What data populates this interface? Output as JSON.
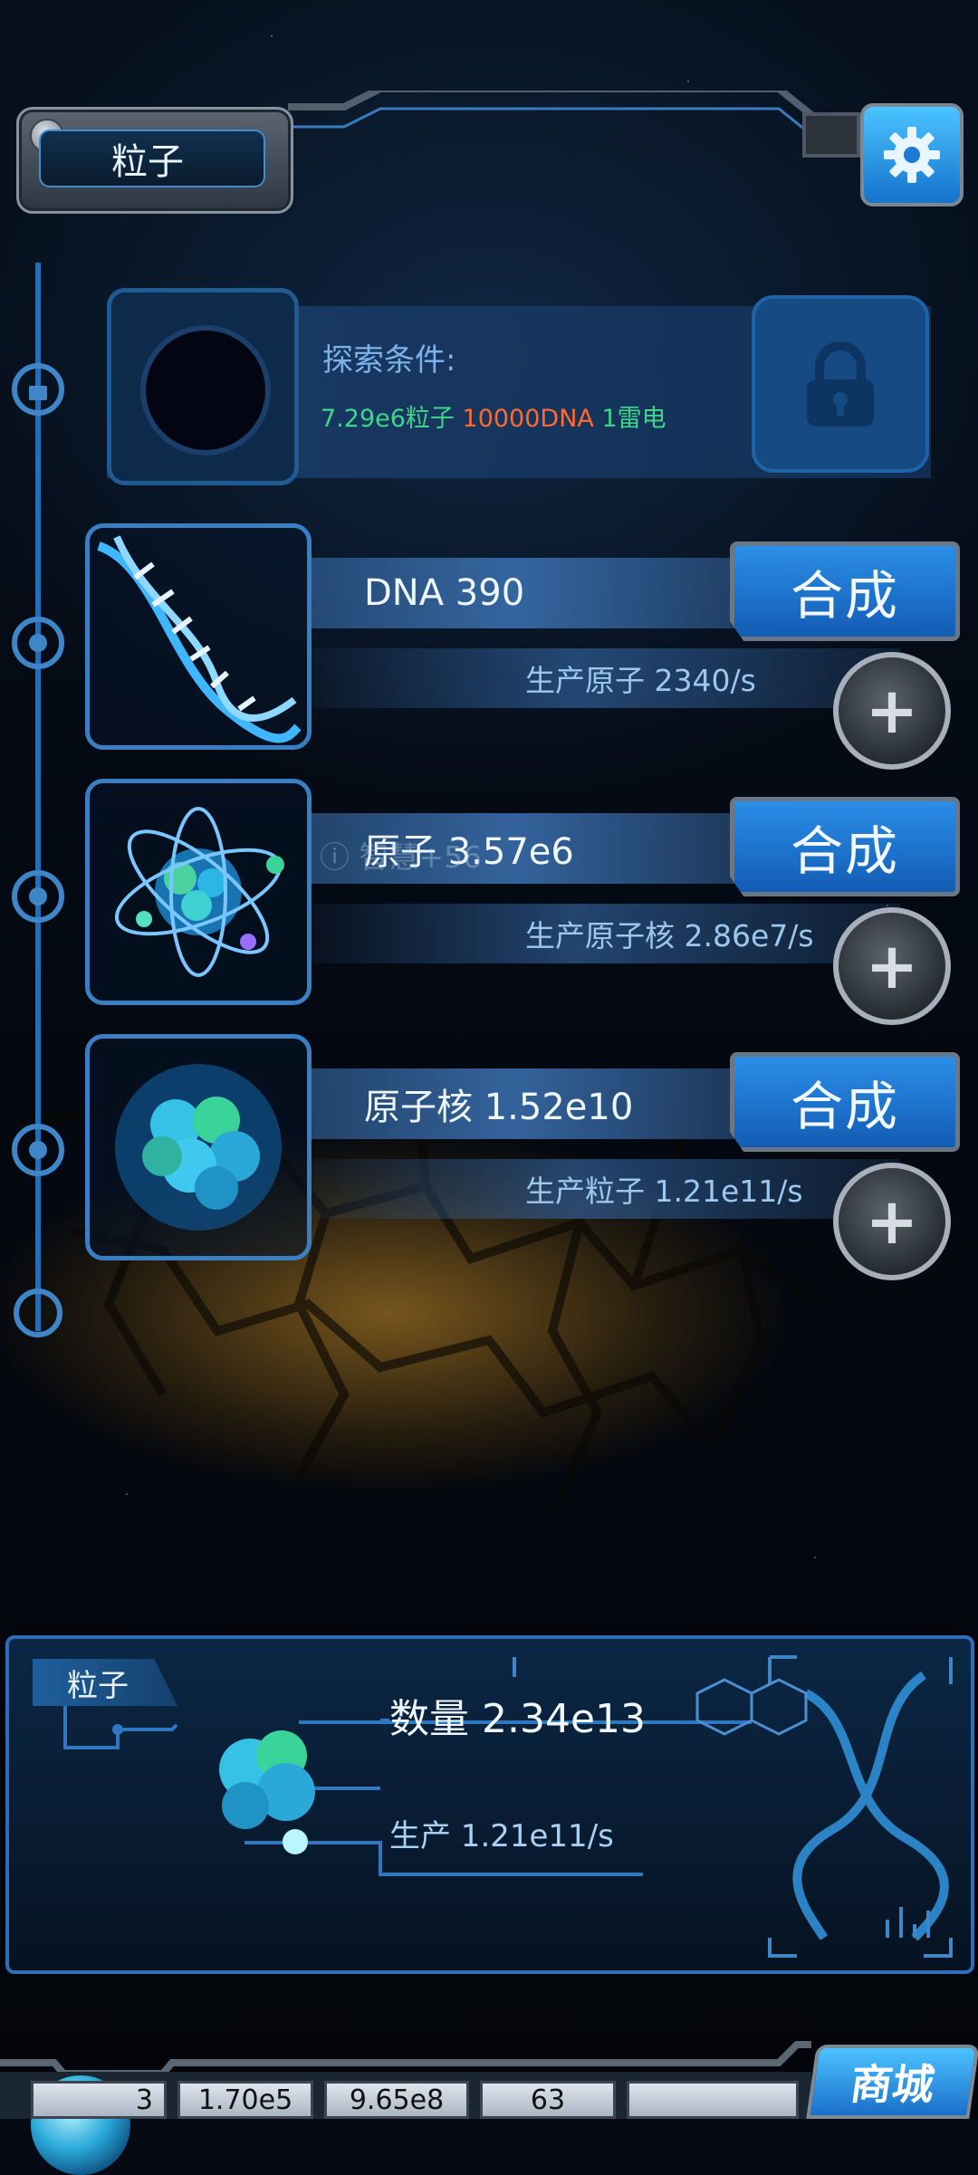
{
  "header": {
    "title": "粒子"
  },
  "locked": {
    "label": "探索条件:",
    "req_particles": "7.29e6粒子",
    "req_dna": "10000DNA",
    "req_thunder": "1雷电"
  },
  "items": [
    {
      "name": "DNA 390",
      "prod": "生产原子 2340/s",
      "button": "合成"
    },
    {
      "name": "原子 3.57e6",
      "prod": "生产原子核 2.86e7/s",
      "button": "合成"
    },
    {
      "name": "原子核 1.52e10",
      "prod": "生产粒子 1.21e11/s",
      "button": "合成"
    }
  ],
  "ghost_text": "智慧+56",
  "info": {
    "tag": "粒子",
    "count": "数量 2.34e13",
    "production": "生产 1.21e11/s"
  },
  "resources": [
    "3",
    "1.70e5",
    "9.65e8",
    "63"
  ],
  "shop": {
    "label": "商城"
  }
}
